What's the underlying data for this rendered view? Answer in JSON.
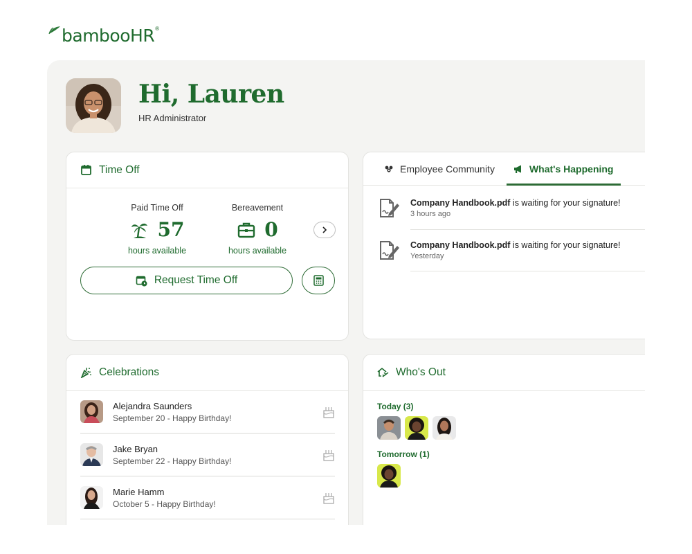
{
  "brand": {
    "name_left": "bamboo",
    "name_right": "HR",
    "registered": "®"
  },
  "header": {
    "greeting": "Hi, Lauren",
    "role": "HR Administrator"
  },
  "time_off": {
    "title": "Time Off",
    "balances": [
      {
        "type": "Paid Time Off",
        "value": "57",
        "unit": "hours available",
        "icon": "palm-tree-icon"
      },
      {
        "type": "Bereavement",
        "value": "0",
        "unit": "hours available",
        "icon": "briefcase-icon"
      }
    ],
    "request_label": "Request Time Off"
  },
  "feed": {
    "tabs": [
      {
        "label": "Employee Community",
        "icon": "community-icon",
        "active": false
      },
      {
        "label": "What's Happening",
        "icon": "megaphone-icon",
        "active": true
      }
    ],
    "items": [
      {
        "file": "Company Handbook.pdf",
        "text": " is waiting for your signature!",
        "time": "3 hours ago"
      },
      {
        "file": "Company Handbook.pdf",
        "text": " is waiting for your signature!",
        "time": "Yesterday"
      }
    ]
  },
  "celebrations": {
    "title": "Celebrations",
    "items": [
      {
        "name": "Alejandra Saunders",
        "detail": "September 20 - Happy Birthday!"
      },
      {
        "name": "Jake Bryan",
        "detail": "September 22 - Happy Birthday!"
      },
      {
        "name": "Marie Hamm",
        "detail": "October 5 - Happy Birthday!"
      }
    ]
  },
  "whos_out": {
    "title": "Who's Out",
    "today_label": "Today (3)",
    "tomorrow_label": "Tomorrow (1)"
  },
  "colors": {
    "brand_green": "#1f6b2e",
    "canvas": "#f4f4f2",
    "card": "#ffffff"
  }
}
